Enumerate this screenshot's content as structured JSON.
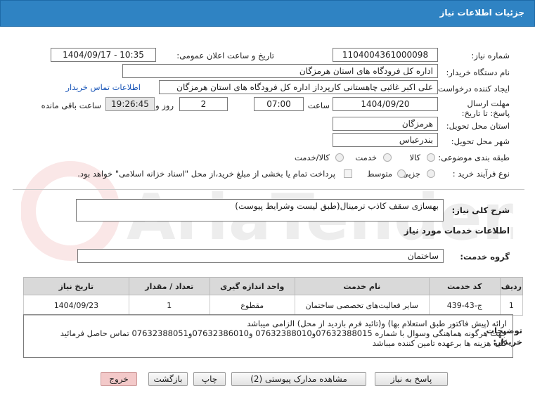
{
  "title": "جزئیات اطلاعات نیاز",
  "need_number": {
    "label": "شماره نیاز:",
    "value": "1104004361000098"
  },
  "announce": {
    "label": "تاریخ و ساعت اعلان عمومی:",
    "value": "1404/09/17 - 10:35"
  },
  "buyer_org": {
    "label": "نام دستگاه خریدار:",
    "value": "اداره کل فرودگاه های استان هرمزگان"
  },
  "creator": {
    "label": "ایجاد کننده درخواست:",
    "value": "علی اکبر غائبی چاهستانی کارپرداز اداره کل فرودگاه های استان هرمزگان",
    "contact_link": "اطلاعات تماس خریدار"
  },
  "deadline": {
    "label": "مهلت ارسال پاسخ: تا تاریخ:",
    "date": "1404/09/20",
    "time_label": "ساعت",
    "time": "07:00",
    "days": "2",
    "days_label": "روز و",
    "remaining": "19:26:45",
    "remaining_label": "ساعت باقی مانده"
  },
  "province": {
    "label": "استان محل تحویل:",
    "value": "هرمزگان"
  },
  "city": {
    "label": "شهر محل تحویل:",
    "value": "بندرعباس"
  },
  "category": {
    "label": "طبقه بندی موضوعی:",
    "options": [
      "کالا",
      "خدمت",
      "کالا/خدمت"
    ]
  },
  "purchase_type": {
    "label": "نوع فرآیند خرید :",
    "options": [
      "جزیی",
      "متوسط"
    ],
    "note": "پرداخت تمام یا بخشی از مبلغ خرید،از محل \"اسناد خزانه اسلامی\" خواهد بود."
  },
  "summary": {
    "label": "شرح کلی نیاز:",
    "value": "بهسازی سقف کاذب ترمینال(طبق لیست وشرایط پیوست)"
  },
  "services_heading": "اطلاعات خدمات مورد نیاز",
  "service_group": {
    "label": "گروه خدمت:",
    "value": "ساختمان"
  },
  "table": {
    "headers": [
      "ردیف",
      "کد خدمت",
      "نام خدمت",
      "واحد اندازه گیری",
      "تعداد / مقدار",
      "تاریخ نیاز"
    ],
    "rows": [
      [
        "1",
        "ج-43-439",
        "سایر فعالیت‌های تخصصی ساختمان",
        "مقطوع",
        "1",
        "1404/09/23"
      ]
    ]
  },
  "buyer_notes": {
    "label": "توضیحات خریدار:",
    "lines": [
      "ارائه (پیش فاکتور طبق استعلام بها)  و(تائید فرم بازدید از محل)  الزامی میباشد",
      "جهت هرگونه هماهنگی وسوال با شماره 07632388015و07632388010 و07632386010و07632388051 تماس حاصل فرمائید",
      "کلیه هزینه ها برعهده تامین کننده میباشد"
    ]
  },
  "buttons": {
    "reply": "پاسخ به نیاز",
    "docs": "مشاهده مدارک پیوستی (2)",
    "print": "چاپ",
    "back": "بازگشت",
    "exit": "خروج"
  },
  "watermark": "AriaTender.net"
}
